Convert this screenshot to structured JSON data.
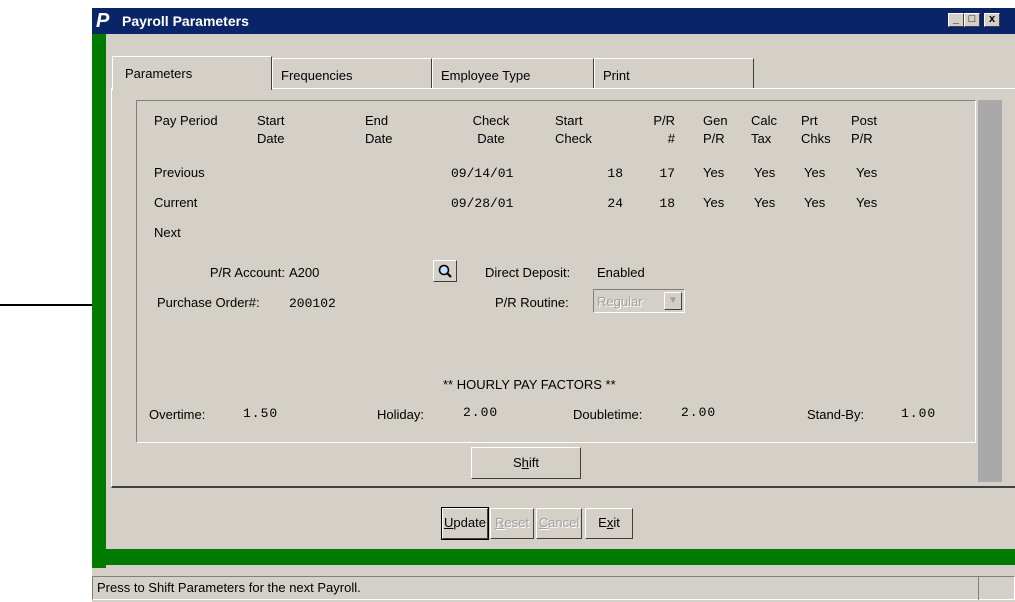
{
  "window": {
    "app_letter": "P",
    "title": "Payroll Parameters",
    "min": "_",
    "max": "□",
    "close": "x"
  },
  "tabs": [
    {
      "label": "Parameters",
      "active": true
    },
    {
      "label": "Frequencies"
    },
    {
      "label": "Employee Type"
    },
    {
      "label": "Print"
    }
  ],
  "table": {
    "headers": {
      "pay_period": "Pay Period",
      "start_date": [
        "Start",
        "Date"
      ],
      "end_date": [
        "End",
        "Date"
      ],
      "check_date": [
        "Check",
        "Date"
      ],
      "start_check": [
        "Start",
        "Check"
      ],
      "pr_num": [
        "P/R",
        "#"
      ],
      "gen_pr": [
        "Gen",
        "P/R"
      ],
      "calc_tax": [
        "Calc",
        "Tax"
      ],
      "prt_chks": [
        "Prt",
        "Chks"
      ],
      "post_pr": [
        "Post",
        "P/R"
      ]
    },
    "rows": [
      {
        "label": "Previous",
        "check_date": "09/14/01",
        "start_check": "18",
        "pr_num": "17",
        "gen": "Yes",
        "calc": "Yes",
        "prt": "Yes",
        "post": "Yes"
      },
      {
        "label": "Current",
        "check_date": "09/28/01",
        "start_check": "24",
        "pr_num": "18",
        "gen": "Yes",
        "calc": "Yes",
        "prt": "Yes",
        "post": "Yes"
      },
      {
        "label": "Next"
      }
    ]
  },
  "fields": {
    "pr_account_label": "P/R Account:",
    "pr_account_value": "A200",
    "purchase_order_label": "Purchase Order#:",
    "purchase_order_value": "200102",
    "direct_deposit_label": "Direct Deposit:",
    "direct_deposit_value": "Enabled",
    "pr_routine_label": "P/R Routine:",
    "pr_routine_value": "Regular"
  },
  "hourly": {
    "title": "** HOURLY PAY FACTORS **",
    "overtime_label": "Overtime:",
    "overtime_value": "1.50",
    "holiday_label": "Holiday:",
    "holiday_value": "2.00",
    "doubletime_label": "Doubletime:",
    "doubletime_value": "2.00",
    "standby_label": "Stand-By:",
    "standby_value": "1.00"
  },
  "buttons": {
    "shift": {
      "pre": "S",
      "ul": "h",
      "post": "ift"
    },
    "update": {
      "pre": "",
      "ul": "U",
      "post": "pdate"
    },
    "reset": {
      "pre": "",
      "ul": "R",
      "post": "eset"
    },
    "cancel": {
      "pre": "",
      "ul": "C",
      "post": "ancel"
    },
    "exit": {
      "pre": "E",
      "ul": "x",
      "post": "it"
    }
  },
  "status": {
    "text": "Press to Shift Parameters for the next Payroll."
  },
  "icons": {
    "lookup": "magnifier-icon",
    "dropdown": "chevron-down-icon",
    "pointer": "arrow-right-icon"
  }
}
